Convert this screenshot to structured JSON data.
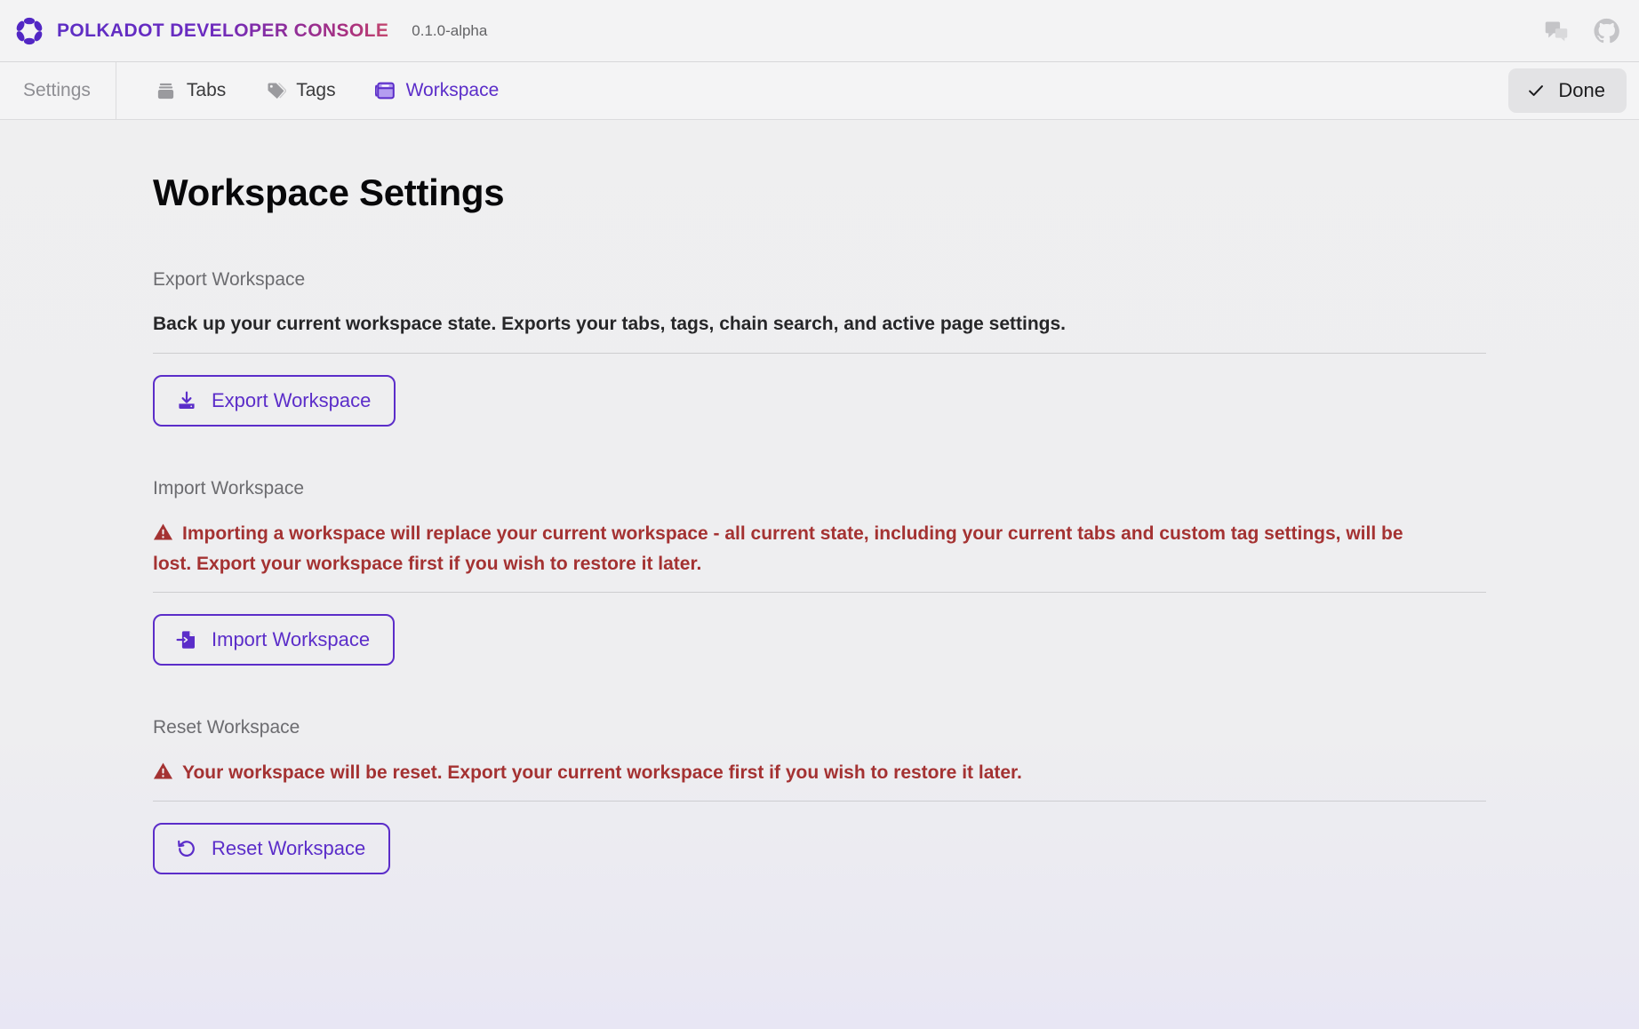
{
  "header": {
    "brand_title": "POLKADOT DEVELOPER CONSOLE",
    "version": "0.1.0-alpha",
    "logo_icon": "polkadot-logo-icon",
    "chat_icon": "chat-bubbles-icon",
    "github_icon": "github-icon",
    "brand_gradient_start": "#5d2ec4",
    "brand_gradient_end": "#c3476f"
  },
  "toolbar": {
    "settings_label": "Settings",
    "tabs": [
      {
        "label": "Tabs",
        "icon": "tabs-icon",
        "active": false
      },
      {
        "label": "Tags",
        "icon": "tag-icon",
        "active": false
      },
      {
        "label": "Workspace",
        "icon": "workspace-window-icon",
        "active": true
      }
    ],
    "done_label": "Done",
    "done_icon": "check-icon",
    "active_color": "#5b2dc9"
  },
  "main": {
    "page_title": "Workspace Settings",
    "sections": [
      {
        "label": "Export Workspace",
        "description": "Back up your current workspace state. Exports your tabs, tags, chain search, and active page settings.",
        "warning": "",
        "button_label": "Export Workspace",
        "button_icon": "download-icon"
      },
      {
        "label": "Import Workspace",
        "description": "",
        "warning": "Importing a workspace will replace your current workspace - all current state, including your current tabs and custom tag settings, will be lost. Export your workspace first if you wish to restore it later.",
        "button_label": "Import Workspace",
        "button_icon": "file-import-icon"
      },
      {
        "label": "Reset Workspace",
        "description": "",
        "warning": "Your workspace will be reset. Export your current workspace first if you wish to restore it later.",
        "button_label": "Reset Workspace",
        "button_icon": "rotate-ccw-icon"
      }
    ],
    "warning_color": "#a43232",
    "accent_color": "#5b2dc9"
  }
}
